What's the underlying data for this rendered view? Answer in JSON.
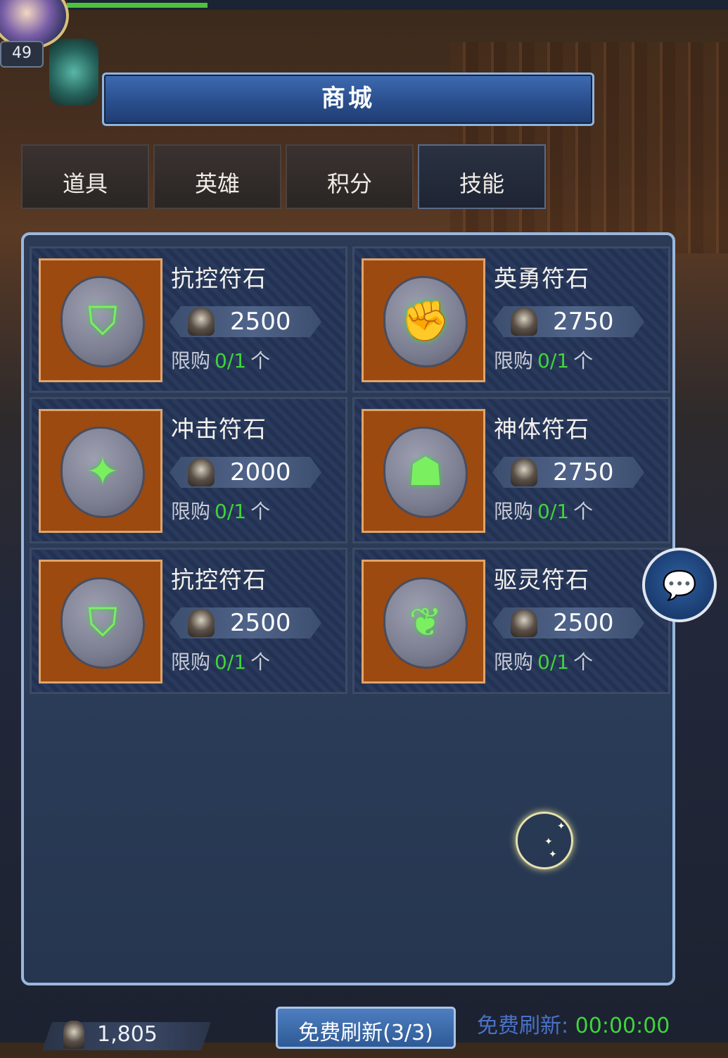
{
  "player": {
    "level": "49"
  },
  "shop": {
    "title": "商城",
    "tabs": [
      {
        "label": "道具"
      },
      {
        "label": "英雄"
      },
      {
        "label": "积分"
      },
      {
        "label": "技能",
        "active": true
      }
    ],
    "items": [
      {
        "name": "抗控符石",
        "price": "2500",
        "limit_prefix": "限购",
        "limit_count": "0/1",
        "limit_suffix": "个",
        "icon": "shield-rune-icon"
      },
      {
        "name": "英勇符石",
        "price": "2750",
        "limit_prefix": "限购",
        "limit_count": "0/1",
        "limit_suffix": "个",
        "icon": "fist-rune-icon"
      },
      {
        "name": "冲击符石",
        "price": "2000",
        "limit_prefix": "限购",
        "limit_count": "0/1",
        "limit_suffix": "个",
        "icon": "impact-rune-icon"
      },
      {
        "name": "神体符石",
        "price": "2750",
        "limit_prefix": "限购",
        "limit_count": "0/1",
        "limit_suffix": "个",
        "icon": "body-rune-icon"
      },
      {
        "name": "抗控符石",
        "price": "2500",
        "limit_prefix": "限购",
        "limit_count": "0/1",
        "limit_suffix": "个",
        "icon": "shield-rune-icon"
      },
      {
        "name": "驱灵符石",
        "price": "2500",
        "limit_prefix": "限购",
        "limit_count": "0/1",
        "limit_suffix": "个",
        "icon": "spirit-rune-icon"
      }
    ]
  },
  "footer": {
    "currency_value": "1,805",
    "refresh_button": "免费刷新(3/3)",
    "refresh_label": "免费刷新:",
    "refresh_time": "00:00:00"
  },
  "colors": {
    "accent_green": "#3fd43c",
    "title_blue": "#2a4f8e",
    "frame_orange": "#9c4a10"
  }
}
